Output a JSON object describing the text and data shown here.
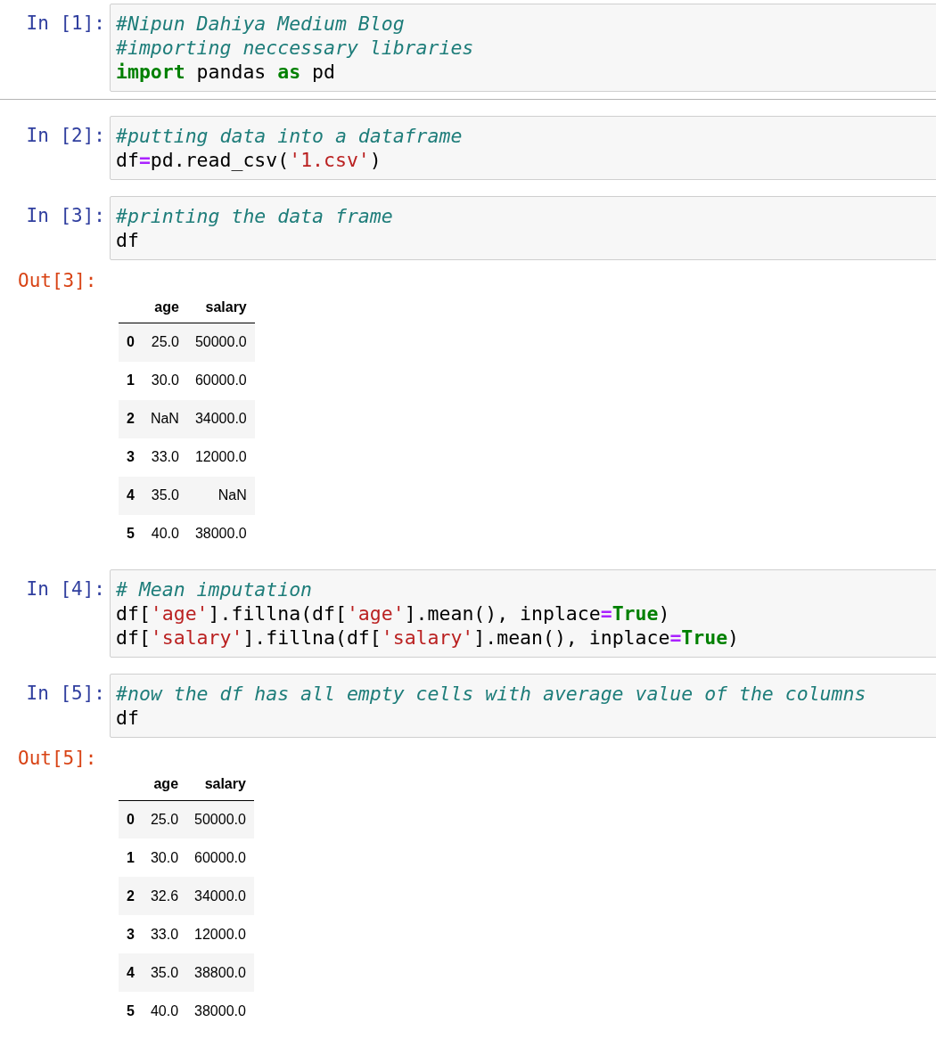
{
  "cells": [
    {
      "prompt": "In [1]:",
      "divider_below": true,
      "lines": [
        [
          {
            "text": "#Nipun Dahiya Medium Blog",
            "kind": "comment"
          }
        ],
        [
          {
            "text": "#importing neccessary libraries",
            "kind": "comment"
          }
        ],
        [
          {
            "text": "import",
            "kind": "keyword"
          },
          {
            "text": " pandas ",
            "kind": "name"
          },
          {
            "text": "as",
            "kind": "keyword"
          },
          {
            "text": " pd",
            "kind": "name"
          }
        ]
      ]
    },
    {
      "prompt": "In [2]:",
      "divider_below": false,
      "lines": [
        [
          {
            "text": "#putting data into a dataframe",
            "kind": "comment"
          }
        ],
        [
          {
            "text": "df",
            "kind": "name"
          },
          {
            "text": "=",
            "kind": "operator"
          },
          {
            "text": "pd.read_csv(",
            "kind": "name"
          },
          {
            "text": "'1.csv'",
            "kind": "string"
          },
          {
            "text": ")",
            "kind": "name"
          }
        ]
      ]
    },
    {
      "prompt": "In [3]:",
      "divider_below": false,
      "lines": [
        [
          {
            "text": "#printing the data frame",
            "kind": "comment"
          }
        ],
        [
          {
            "text": "df",
            "kind": "name"
          }
        ]
      ],
      "output": {
        "prompt": "Out[3]:",
        "columns": [
          "age",
          "salary"
        ],
        "rows": [
          {
            "index": "0",
            "values": [
              "25.0",
              "50000.0"
            ]
          },
          {
            "index": "1",
            "values": [
              "30.0",
              "60000.0"
            ]
          },
          {
            "index": "2",
            "values": [
              "NaN",
              "34000.0"
            ]
          },
          {
            "index": "3",
            "values": [
              "33.0",
              "12000.0"
            ]
          },
          {
            "index": "4",
            "values": [
              "35.0",
              "NaN"
            ]
          },
          {
            "index": "5",
            "values": [
              "40.0",
              "38000.0"
            ]
          }
        ]
      }
    },
    {
      "prompt": "In [4]:",
      "divider_below": false,
      "lines": [
        [
          {
            "text": "# Mean imputation",
            "kind": "comment"
          }
        ],
        [
          {
            "text": "df[",
            "kind": "name"
          },
          {
            "text": "'age'",
            "kind": "string"
          },
          {
            "text": "].fillna(df[",
            "kind": "name"
          },
          {
            "text": "'age'",
            "kind": "string"
          },
          {
            "text": "].mean(), inplace",
            "kind": "name"
          },
          {
            "text": "=",
            "kind": "operator"
          },
          {
            "text": "True",
            "kind": "keyword"
          },
          {
            "text": ")",
            "kind": "name"
          }
        ],
        [
          {
            "text": "df[",
            "kind": "name"
          },
          {
            "text": "'salary'",
            "kind": "string"
          },
          {
            "text": "].fillna(df[",
            "kind": "name"
          },
          {
            "text": "'salary'",
            "kind": "string"
          },
          {
            "text": "].mean(), inplace",
            "kind": "name"
          },
          {
            "text": "=",
            "kind": "operator"
          },
          {
            "text": "True",
            "kind": "keyword"
          },
          {
            "text": ")",
            "kind": "name"
          }
        ]
      ]
    },
    {
      "prompt": "In [5]:",
      "divider_below": false,
      "lines": [
        [
          {
            "text": "#now the df has all empty cells with average value of the columns",
            "kind": "comment"
          }
        ],
        [
          {
            "text": "df",
            "kind": "name"
          }
        ]
      ],
      "output": {
        "prompt": "Out[5]:",
        "columns": [
          "age",
          "salary"
        ],
        "rows": [
          {
            "index": "0",
            "values": [
              "25.0",
              "50000.0"
            ]
          },
          {
            "index": "1",
            "values": [
              "30.0",
              "60000.0"
            ]
          },
          {
            "index": "2",
            "values": [
              "32.6",
              "34000.0"
            ]
          },
          {
            "index": "3",
            "values": [
              "33.0",
              "12000.0"
            ]
          },
          {
            "index": "4",
            "values": [
              "35.0",
              "38800.0"
            ]
          },
          {
            "index": "5",
            "values": [
              "40.0",
              "38000.0"
            ]
          }
        ]
      }
    }
  ]
}
